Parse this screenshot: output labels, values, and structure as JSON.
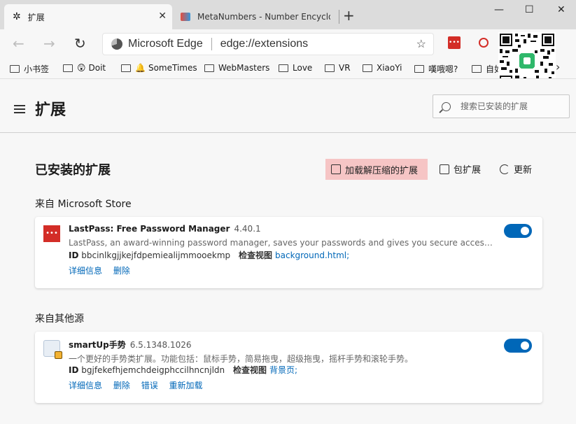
{
  "tabs": [
    {
      "title": "扩展",
      "active": true
    },
    {
      "title": "MetaNumbers - Number Encyclo",
      "active": false
    }
  ],
  "address_bar": {
    "brand": "Microsoft Edge",
    "url": "edge://extensions"
  },
  "bookmarks": [
    {
      "label": "小书签"
    },
    {
      "label": "Doit",
      "emoji": "😲"
    },
    {
      "label": "SomeTimes",
      "emoji": "🔔"
    },
    {
      "label": "WebMasters"
    },
    {
      "label": "Love"
    },
    {
      "label": "VR"
    },
    {
      "label": "XiaoYi"
    },
    {
      "label": "嘆哦嗯?"
    },
    {
      "label": "自如"
    }
  ],
  "header": {
    "title": "扩展",
    "search_placeholder": "搜索已安装的扩展"
  },
  "installed": {
    "title": "已安装的扩展",
    "load_unpacked": "加载解压缩的扩展",
    "pack": "包扩展",
    "update": "更新"
  },
  "sources": [
    {
      "label": "来自 Microsoft Store",
      "extension": {
        "name": "LastPass: Free Password Manager",
        "version": "4.40.1",
        "description": "LastPass, an award-winning password manager, saves your passwords and gives you secure access from every computer and mobile device.",
        "id_label": "ID",
        "id": "bbcinlkgjjkejfdpemiealijmmooekmp",
        "inspect_label": "检查视图",
        "inspect_link": "background.html;",
        "links": [
          "详细信息",
          "删除"
        ],
        "enabled": true
      }
    },
    {
      "label": "来自其他源",
      "extension": {
        "name": "smartUp手势",
        "version": "6.5.1348.1026",
        "description": "一个更好的手势类扩展。功能包括：鼠标手势，简易拖曳，超级拖曳，摇杆手势和滚轮手势。",
        "id_label": "ID",
        "id": "bgjfekefhjemchdeigphccilhncnjldn",
        "inspect_label": "检查视图",
        "inspect_link": "背景页;",
        "links": [
          "详细信息",
          "删除",
          "错误",
          "重新加载"
        ],
        "enabled": true
      }
    }
  ],
  "colors": {
    "accent": "#0067b8",
    "highlight": "#f6c5c5",
    "lastpass_red": "#d32d27"
  }
}
